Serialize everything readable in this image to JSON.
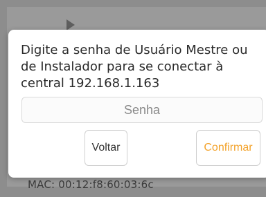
{
  "background": {
    "mac_text": "MAC: 00:12:f8:60:03:6c"
  },
  "dialog": {
    "message": "Digite a senha de Usuário Mestre ou de Instalador para se conectar à central 192.168.1.163",
    "password_placeholder": "Senha",
    "password_value": "",
    "buttons": {
      "back_label": "Voltar",
      "confirm_label": "Confirmar"
    }
  },
  "colors": {
    "overlay": "#8d8d8d",
    "dialog_bg": "#ffffff",
    "confirm_accent": "#f3a32c",
    "text": "#2a2a2a"
  },
  "icons": {
    "background_chevron": "play-arrow-icon"
  }
}
